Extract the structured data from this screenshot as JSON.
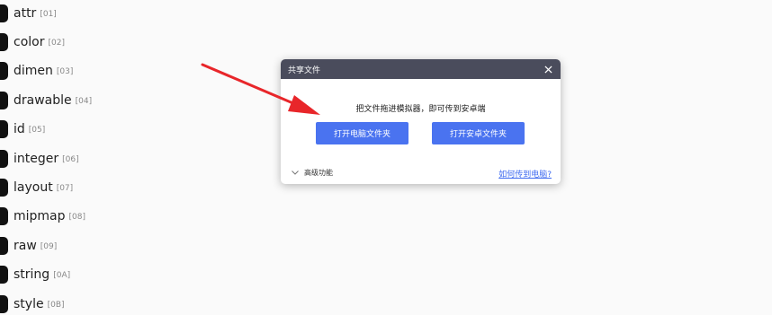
{
  "folders": [
    {
      "name": "attr",
      "code": "[01]"
    },
    {
      "name": "color",
      "code": "[02]"
    },
    {
      "name": "dimen",
      "code": "[03]"
    },
    {
      "name": "drawable",
      "code": "[04]"
    },
    {
      "name": "id",
      "code": "[05]"
    },
    {
      "name": "integer",
      "code": "[06]"
    },
    {
      "name": "layout",
      "code": "[07]"
    },
    {
      "name": "mipmap",
      "code": "[08]"
    },
    {
      "name": "raw",
      "code": "[09]"
    },
    {
      "name": "string",
      "code": "[0A]"
    },
    {
      "name": "style",
      "code": "[0B]"
    }
  ],
  "dialog": {
    "title": "共享文件",
    "message": "把文件拖进模拟器，即可传到安卓端",
    "open_pc_folder": "打开电脑文件夹",
    "open_android_folder": "打开安卓文件夹",
    "advanced": "高级功能",
    "help_link": "如何传到电脑?"
  },
  "colors": {
    "title_bar": "#4a4c5c",
    "button": "#4a73f0",
    "link": "#3f6bf0",
    "arrow": "#e8262a"
  },
  "icons": {
    "folder": "folder-icon",
    "close": "close-icon",
    "expand": "chevron-down-icon"
  }
}
